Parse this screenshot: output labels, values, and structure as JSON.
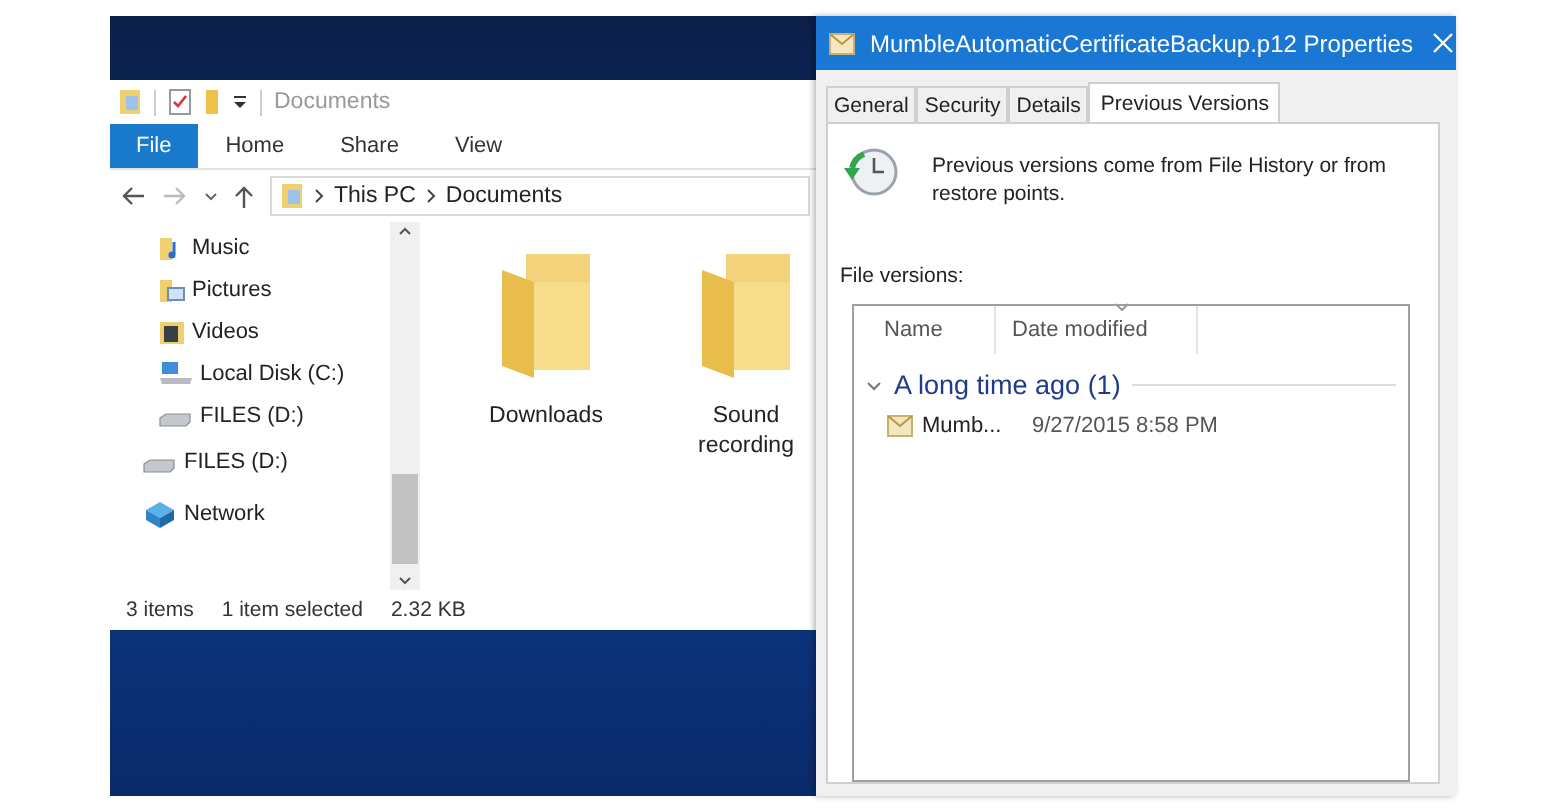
{
  "explorer": {
    "quick_access_title": "Documents",
    "ribbon_tabs": [
      {
        "label": "File",
        "kind": "file"
      },
      {
        "label": "Home",
        "kind": "tab"
      },
      {
        "label": "Share",
        "kind": "tab"
      },
      {
        "label": "View",
        "kind": "tab"
      }
    ],
    "breadcrumbs": [
      "This PC",
      "Documents"
    ],
    "nav_pane": {
      "nested_items": [
        {
          "label": "Music",
          "kind": "music"
        },
        {
          "label": "Pictures",
          "kind": "pictures"
        },
        {
          "label": "Videos",
          "kind": "videos"
        },
        {
          "label": "Local Disk (C:)",
          "kind": "disk"
        },
        {
          "label": "FILES (D:)",
          "kind": "drive"
        }
      ],
      "items": [
        {
          "label": "FILES (D:)",
          "kind": "drive"
        },
        {
          "label": "Network",
          "kind": "network"
        }
      ]
    },
    "folders": [
      {
        "label": "Downloads"
      },
      {
        "label": "Sound recording"
      }
    ],
    "status_bar": [
      "3 items",
      "1 item selected",
      "2.32 KB"
    ]
  },
  "properties_dialog": {
    "title": "MumbleAutomaticCertificateBackup.p12 Properties",
    "tabs": [
      {
        "label": "General",
        "selected": false
      },
      {
        "label": "Security",
        "selected": false
      },
      {
        "label": "Details",
        "selected": false
      },
      {
        "label": "Previous Versions",
        "selected": true
      }
    ],
    "description": "Previous versions come from File History or from restore points.",
    "versions_label": "File versions:",
    "columns": [
      "Name",
      "Date modified"
    ],
    "groups": [
      {
        "title": "A long time ago (1)",
        "expanded": true,
        "rows": [
          {
            "name": "Mumb...",
            "date_modified": "9/27/2015 8:58 PM"
          }
        ]
      }
    ]
  }
}
